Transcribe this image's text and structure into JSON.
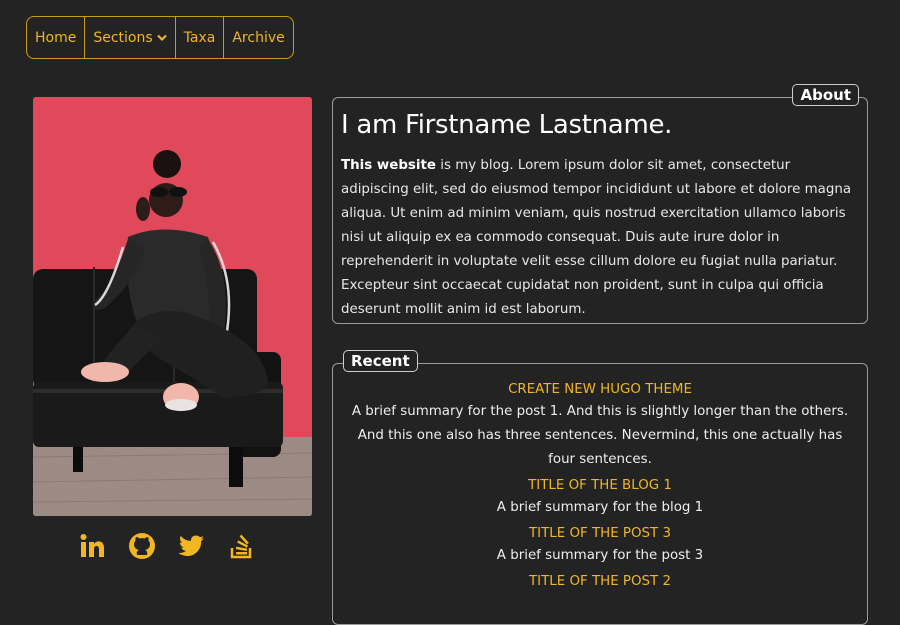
{
  "nav": {
    "items": [
      {
        "label": "Home"
      },
      {
        "label": "Sections"
      },
      {
        "label": "Taxa"
      },
      {
        "label": "Archive"
      }
    ]
  },
  "social": [
    "linkedin-icon",
    "github-icon",
    "twitter-icon",
    "stackoverflow-icon"
  ],
  "about": {
    "legend": "About",
    "heading": "I am Firstname Lastname.",
    "intro_bold": "This website",
    "intro_rest": " is my blog. Lorem ipsum dolor sit amet, consectetur adipiscing elit, sed do eiusmod tempor incididunt ut labore et dolore magna aliqua. Ut enim ad minim veniam, quis nostrud exercitation ullamco laboris nisi ut aliquip ex ea commodo consequat. Duis aute irure dolor in reprehenderit in voluptate velit esse cillum dolore eu fugiat nulla pariatur. Excepteur sint occaecat cupidatat non proident, sunt in culpa qui officia deserunt mollit anim id est laborum."
  },
  "recent": {
    "legend": "Recent",
    "posts": [
      {
        "title": "CREATE NEW HUGO THEME",
        "summary": "A brief summary for the post 1. And this is slightly longer than the others. And this one also has three sentences. Nevermind, this one actually has four sentences."
      },
      {
        "title": "TITLE OF THE BLOG 1",
        "summary": "A brief summary for the blog 1"
      },
      {
        "title": "TITLE OF THE POST 3",
        "summary": "A brief summary for the post 3"
      },
      {
        "title": "TITLE OF THE POST 2",
        "summary": ""
      }
    ]
  },
  "colors": {
    "accent": "#f0b624",
    "background": "#232323",
    "photo_wall": "#e0495a"
  }
}
